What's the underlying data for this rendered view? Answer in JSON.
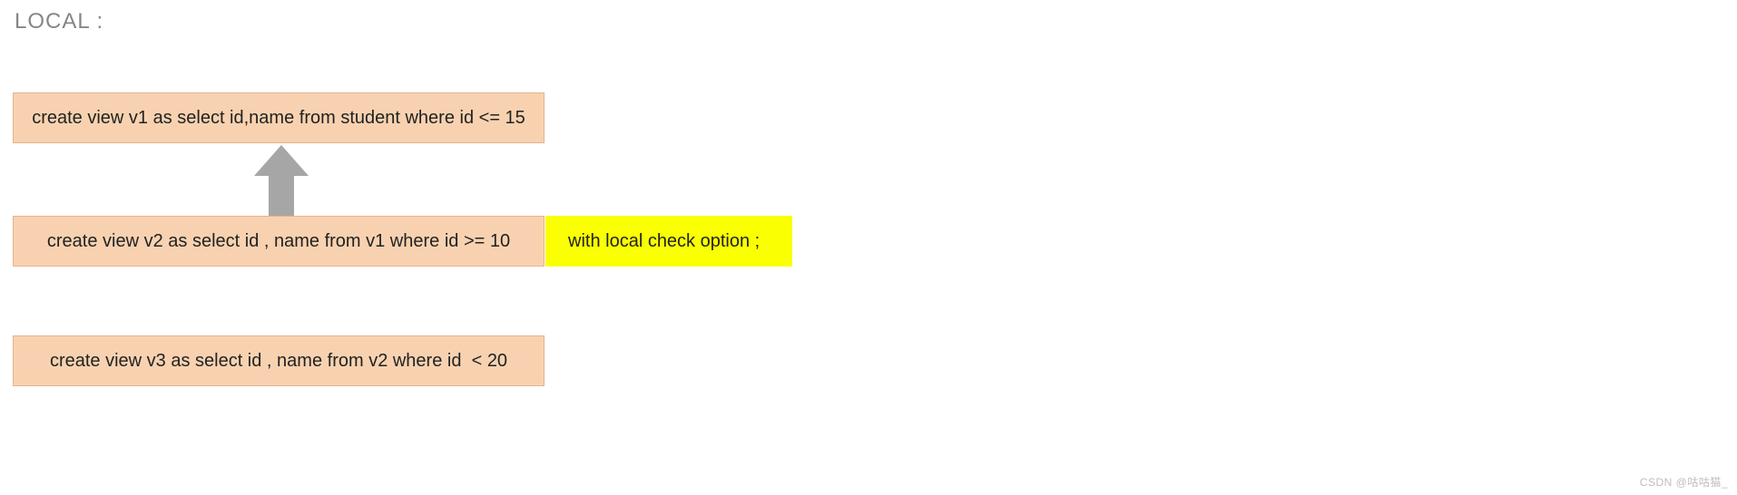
{
  "title": "LOCAL :",
  "boxes": {
    "v1": "create view v1 as select id,name from student where id <= 15",
    "v2": "create view v2 as select id , name from v1 where id >= 10",
    "opt": "with local check option ;",
    "v3": "create view v3 as select id , name from v2 where id  < 20"
  },
  "watermark": "CSDN @咕咕猫_",
  "icons": {
    "arrow_up": "arrow-up-icon"
  },
  "colors": {
    "box_bg": "#f8d2b0",
    "box_border": "#e8b28a",
    "highlight": "#faff02",
    "arrow": "#a6a6a6",
    "title_text": "#868686"
  },
  "chart_data": {
    "type": "diagram",
    "title": "LOCAL check option — view dependency chain",
    "nodes": [
      {
        "id": "v1",
        "sql": "create view v1 as select id,name from student where id <= 15",
        "check_option": null
      },
      {
        "id": "v2",
        "sql": "create view v2 as select id , name from v1 where id >= 10",
        "check_option": "LOCAL"
      },
      {
        "id": "v3",
        "sql": "create view v3 as select id , name from v2 where id  < 20",
        "check_option": null
      }
    ],
    "edges": [
      {
        "from": "v2",
        "to": "v1",
        "meaning": "v2 depends on v1 (arrow points up)"
      }
    ],
    "annotations": [
      {
        "on": "v2",
        "text": "with local check option ;",
        "highlight": true
      }
    ]
  }
}
